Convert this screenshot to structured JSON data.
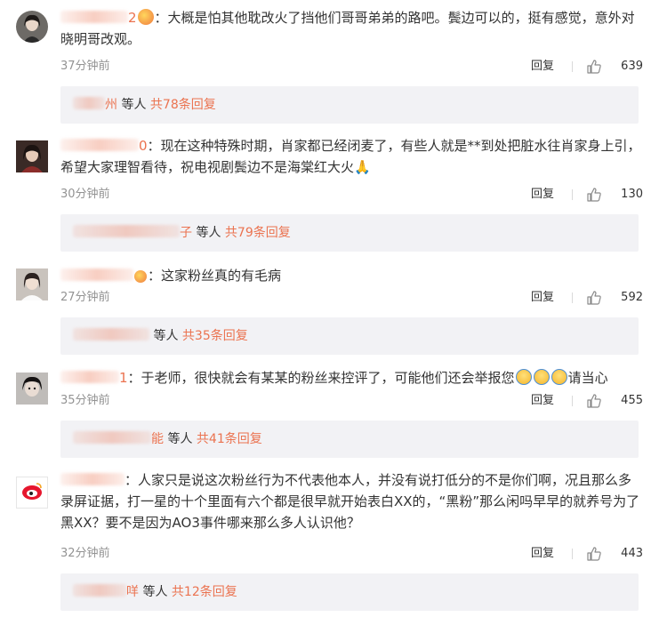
{
  "colors": {
    "accent": "#eb7350",
    "muted": "#939393",
    "panel": "#f2f2f5"
  },
  "labels": {
    "reply": "回复",
    "others": "等人"
  },
  "comments": [
    {
      "user_tail": "2",
      "text_a": "：大概是怕其他耽改火了挡他们哥哥弟弟的路吧。",
      "text_b": "鬓边可以的，挺有感觉，意外对晓明哥改观。",
      "time": "37分钟前",
      "likes": "639",
      "reply_user_tail": "州",
      "reply_count": "共78条回复"
    },
    {
      "user_tail": "0",
      "text_a": "：现在这种特殊时期，肖家都已经闭麦了，有些人就是**到处把脏水往肖家身上引，",
      "text_b": "希望大家理智看待，祝电视剧鬓边不是海棠红大火🙏",
      "time": "30分钟前",
      "likes": "130",
      "reply_user_tail": "子",
      "reply_count": "共79条回复"
    },
    {
      "user_tail": "",
      "text_a": "：这家粉丝真的有毛病",
      "text_b": "",
      "time": "27分钟前",
      "likes": "592",
      "reply_user_tail": "",
      "reply_count": "共35条回复"
    },
    {
      "user_tail": "1",
      "text_a": "：于老师，很快就会有某某的粉丝来控评了，可能他们还会举报您",
      "text_b": "请当心",
      "time": "35分钟前",
      "likes": "455",
      "reply_user_tail": "能",
      "reply_count": "共41条回复"
    },
    {
      "user_tail": "",
      "text_a": "：人家只是说这次粉丝行为不代表他本人，并没有说打低分的不是你们啊，况且那么多",
      "text_b": "录屏证据，打一星的十个里面有六个都是很早就开始表白XX的，“黑粉”那么闲吗早早的就养号为了",
      "text_c": "黑XX？要不是因为AO3事件哪来那么多人认识他？",
      "time": "32分钟前",
      "likes": "443",
      "reply_user_tail": "咩",
      "reply_count": "共12条回复"
    }
  ]
}
